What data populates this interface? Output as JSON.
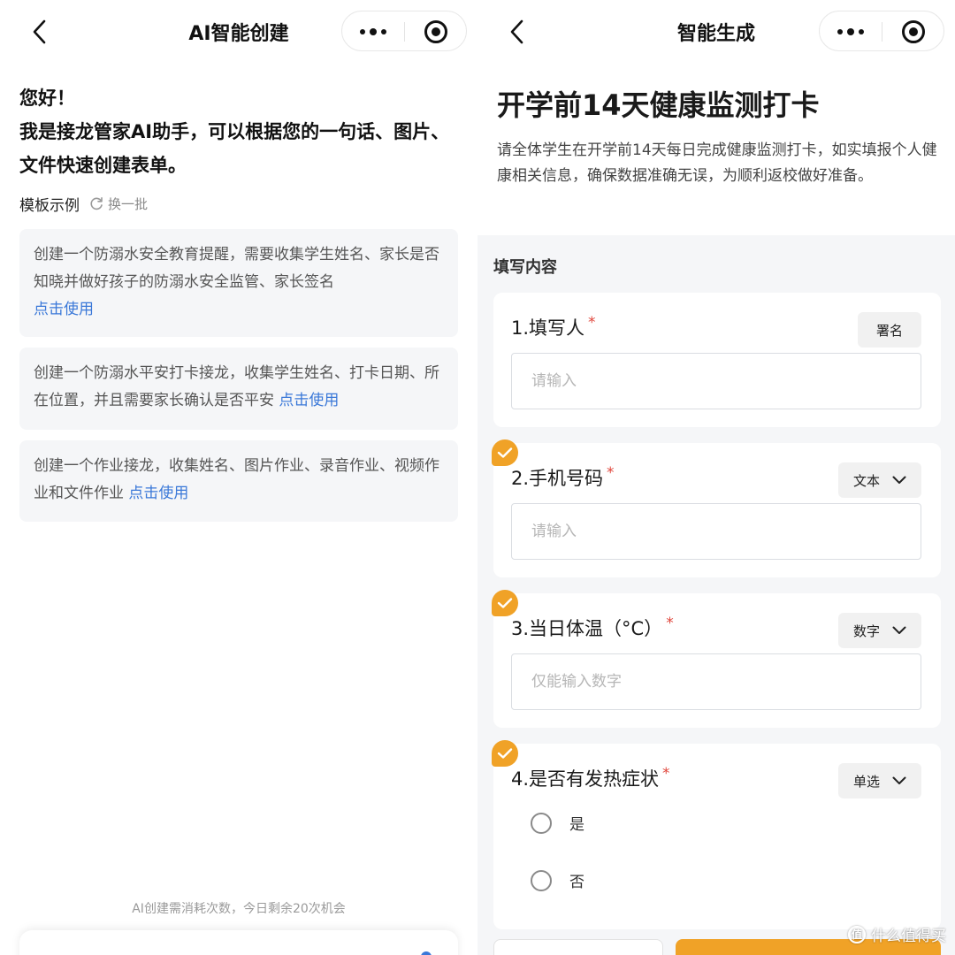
{
  "left": {
    "nav": {
      "title": "AI智能创建"
    },
    "greeting": {
      "line1": "您好！",
      "line2": "我是接龙管家AI助手，可以根据您的一句话、图片、文件快速创建表单。"
    },
    "templates": {
      "label": "模板示例",
      "refresh_label": "换一批",
      "use_label": "点击使用",
      "items": [
        {
          "text": "创建一个防溺水安全教育提醒，需要收集学生姓名、家长是否知晓并做好孩子的防溺水安全监管、家长签名"
        },
        {
          "text": "创建一个防溺水平安打卡接龙，收集学生姓名、打卡日期、所在位置，并且需要家长确认是否平安"
        },
        {
          "text": "创建一个作业接龙，收集姓名、图片作业、录音作业、视频作业和文件作业"
        }
      ]
    },
    "quota_text": "AI创建需消耗次数，今日剩余20次机会"
  },
  "right": {
    "nav": {
      "title": "智能生成"
    },
    "form": {
      "title": "开学前14天健康监测打卡",
      "description": "请全体学生在开学前14天每日完成健康监测打卡，如实填报个人健康相关信息，确保数据准确无误，为顺利返校做好准备。",
      "section_label": "填写内容",
      "required_mark": "*",
      "questions": [
        {
          "title": "1.填写人",
          "tag": "署名",
          "placeholder": "请输入"
        },
        {
          "title": "2.手机号码",
          "tag": "文本",
          "placeholder": "请输入"
        },
        {
          "title": "3.当日体温（°C）",
          "tag": "数字",
          "placeholder": "仅能输入数字"
        },
        {
          "title": "4.是否有发热症状",
          "tag": "单选",
          "options": [
            "是",
            "否"
          ]
        }
      ]
    }
  },
  "watermark": {
    "text": "什么值得买",
    "logo_char": "值"
  },
  "colors": {
    "accent_orange": "#f0a227",
    "link_blue": "#3a78d8",
    "required_red": "#e0463c"
  }
}
